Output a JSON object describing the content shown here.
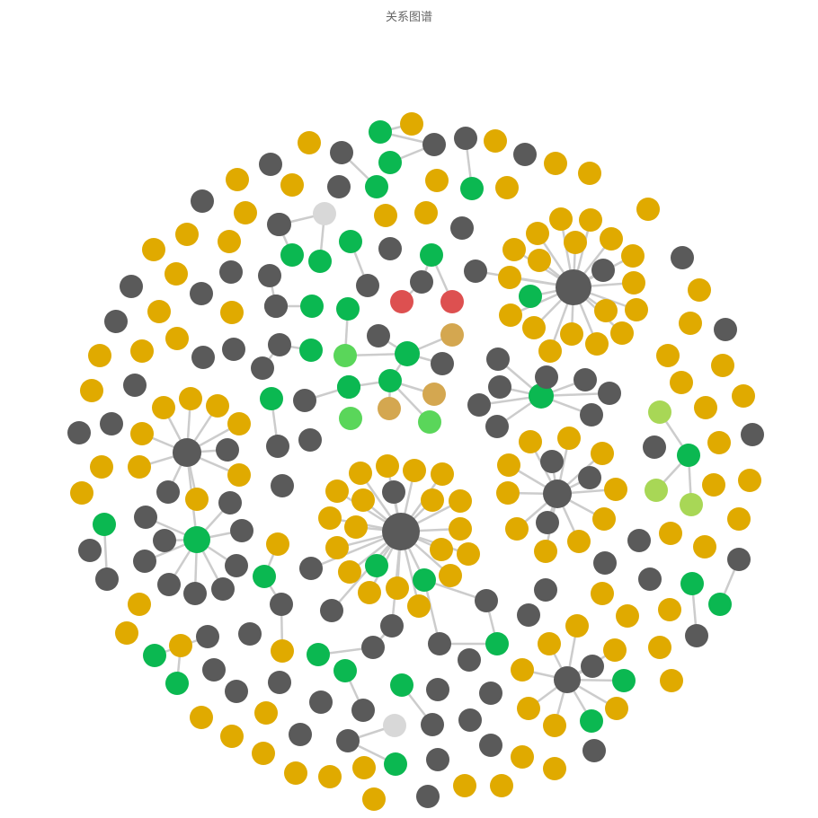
{
  "title": "关系图谱",
  "colors": {
    "gray": "#5a5a5a",
    "yellow": "#e0aa00",
    "green": "#0bb851",
    "lightgreen": "#5ad65a",
    "lime": "#a8d756",
    "tan": "#d4a750",
    "red": "#dd5050",
    "silver": "#d8d8d8",
    "edge": "#cccccc"
  }
}
